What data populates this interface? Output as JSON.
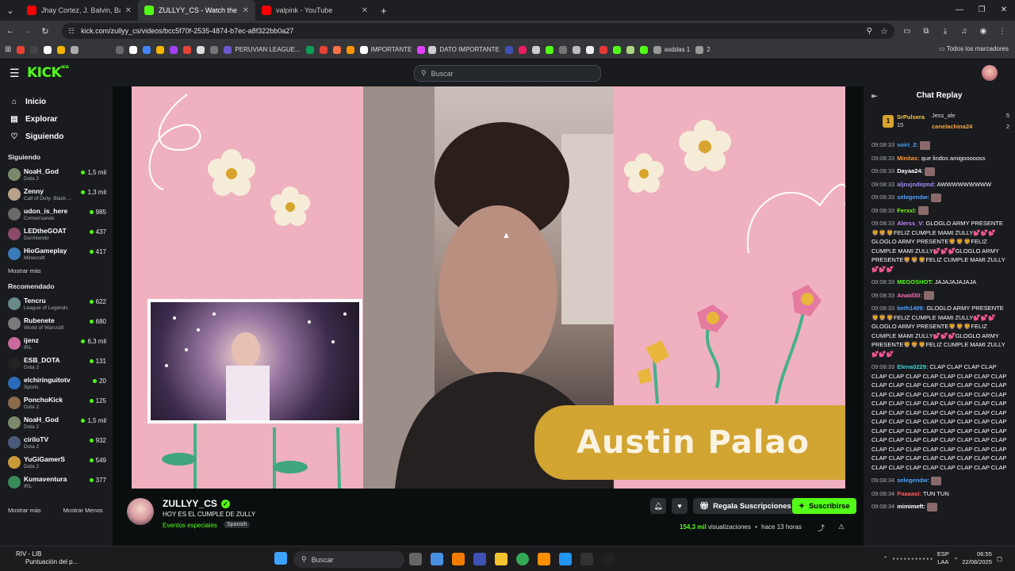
{
  "browser": {
    "tabs": [
      {
        "title": "Jhay Cortez, J. Balvin, Bad Bunny",
        "color": "#ff0000",
        "active": false
      },
      {
        "title": "ZULLYY_CS - Watch the VOD",
        "color": "#53fc18",
        "active": true
      },
      {
        "title": "valpink - YouTube",
        "color": "#ff0000",
        "active": false
      }
    ],
    "new_tab": "+",
    "url": "kick.com/zullyy_cs/videos/bcc5f70f-2535-4874-b7ec-a8f322bb0a27",
    "bookmarks": [
      "PERUVIAN LEAGUE...",
      "IMPORTANTE",
      "DATO IMPORTANTE",
      "asddas 1",
      "2"
    ],
    "all_bookmarks": "Todos los marcadores"
  },
  "kick": {
    "logo": "KICK",
    "logo_badge": "BETA",
    "search_placeholder": "Buscar",
    "nav": [
      {
        "label": "Inicio",
        "icon": "home-icon",
        "glyph": "⌂"
      },
      {
        "label": "Explorar",
        "icon": "browse-icon",
        "glyph": "▤"
      },
      {
        "label": "Siguiendo",
        "icon": "heart-icon",
        "glyph": "♡"
      }
    ],
    "following_title": "Siguiendo",
    "following": [
      {
        "name": "NoaH_God",
        "category": "Dota 2",
        "viewers": "1,5 mil",
        "color": "#7a8a6a"
      },
      {
        "name": "Zenny",
        "category": "Call of Duty: Black ...",
        "viewers": "1,3 mil",
        "color": "#b8a28a"
      },
      {
        "name": "udon_is_here",
        "category": "Conversando",
        "viewers": "985",
        "color": "#6a6a6a"
      },
      {
        "name": "LEDtheGOAT",
        "category": "Durmiendo",
        "viewers": "437",
        "color": "#8a4a6a"
      },
      {
        "name": "HioGameplay",
        "category": "Minecraft",
        "viewers": "417",
        "color": "#3a7ab8"
      }
    ],
    "show_more": "Mostrar más",
    "recommended_title": "Recomendado",
    "recommended": [
      {
        "name": "Tencru",
        "category": "League of Legends",
        "viewers": "622",
        "color": "#6a8a8a"
      },
      {
        "name": "Rubenete",
        "category": "World of Warcraft",
        "viewers": "680",
        "color": "#7a7a7a"
      },
      {
        "name": "ijenz",
        "category": "IRL",
        "viewers": "6,3 mil",
        "color": "#c86a9a"
      },
      {
        "name": "ESB_DOTA",
        "category": "Dota 2",
        "viewers": "131",
        "color": "#222222"
      },
      {
        "name": "elchiringuitotv",
        "category": "Sports",
        "viewers": "20",
        "color": "#2a6ab8"
      },
      {
        "name": "PonchoKick",
        "category": "Dota 2",
        "viewers": "125",
        "color": "#8a6a4a"
      },
      {
        "name": "NoaH_God",
        "category": "Dota 2",
        "viewers": "1,5 mil",
        "color": "#7a8a6a"
      },
      {
        "name": "ciriloTV",
        "category": "Dota 2",
        "viewers": "932",
        "color": "#4a5a7a"
      },
      {
        "name": "YuGiGamerS",
        "category": "Dota 2",
        "viewers": "549",
        "color": "#c89a3a"
      },
      {
        "name": "Kumaventura",
        "category": "IRL",
        "viewers": "377",
        "color": "#3a8a5a"
      }
    ],
    "show_more_2": "Mostrar más",
    "show_less": "Mostrar Menos"
  },
  "video": {
    "banner": "Austin Palao"
  },
  "channel": {
    "name": "ZULLYY_CS",
    "title": "HOY ES EL CUMPLE DE ZULLY",
    "category": "Eventos especiales",
    "language": "Spanish",
    "gift_label": "Regala Suscripciones",
    "subscribe_label": "Suscribirse",
    "views": "154,3 mil",
    "views_label": "visualizaciones",
    "sep": "•",
    "time_ago": "hace 13 horas"
  },
  "chat": {
    "title": "Chat Replay",
    "leaders": [
      {
        "rank": "1",
        "name": "SrPulsera",
        "count": "15"
      },
      {
        "name": "Jess_ale",
        "count": "5"
      },
      {
        "name": "canelachina24",
        "count": "2"
      }
    ],
    "messages": [
      {
        "time": "09:08:33",
        "user": "soiri_2:",
        "color": "#4fa3ff",
        "text": "",
        "emote": true
      },
      {
        "time": "09:08:33",
        "user": "Minitas:",
        "color": "#ff9a3c",
        "text": "que lindos amigoooooss",
        "emote": false
      },
      {
        "time": "09:08:33",
        "user": "Dayaa24:",
        "color": "#ffffff",
        "text": "",
        "emote": true
      },
      {
        "time": "09:08:33",
        "user": "aljnxjndiqmd:",
        "color": "#a78bfa",
        "text": "AWWWWWWWWW",
        "emote": false
      },
      {
        "time": "09:08:33",
        "user": "selegendw:",
        "color": "#4fa3ff",
        "text": "",
        "emote": true
      },
      {
        "time": "09:08:33",
        "user": "Ferxxl:",
        "color": "#7cfc00",
        "text": "",
        "emote": true
      },
      {
        "time": "09:08:33",
        "user": "Alerss_V:",
        "color": "#c084fc",
        "text": "GLOGLO ARMY PRESENTE 🦁🦁🦁FELIZ CUMPLE MAMI ZULLY💕💕💕 GLOGLO ARMY PRESENTE🦁🦁🦁FELIZ CUMPLE MAMI ZULLY💕💕💕GLOGLO ARMY PRESENTE🦁🦁🦁FELIZ CUMPLE MAMI ZULLY💕💕💕",
        "emote": false
      },
      {
        "time": "09:08:33",
        "user": "MEGOSHOT:",
        "color": "#53fc18",
        "text": "JAJAJAJAJAJA",
        "emote": false
      },
      {
        "time": "09:08:33",
        "user": "Anaid30:",
        "color": "#ff6eb4",
        "text": "",
        "emote": true
      },
      {
        "time": "09:08:33",
        "user": "beth1409:",
        "color": "#4fa3ff",
        "text": "GLOGLO ARMY PRESENTE🦁🦁🦁FELIZ CUMPLE MAMI ZULLY💕💕💕 GLOGLO ARMY PRESENTE🦁🦁🦁FELIZ CUMPLE MAMI ZULLY💕💕💕GLOGLO ARMY PRESENTE🦁🦁🦁FELIZ CUMPLE MAMI ZULLY💕💕💕",
        "emote": false
      },
      {
        "time": "09:08:33",
        "user": "Elena0229:",
        "color": "#3ccfcf",
        "text": "CLAP CLAP CLAP CLAP CLAP CLAP CLAP CLAP CLAP CLAP CLAP CLAP CLAP CLAP CLAP CLAP CLAP CLAP CLAP CLAP CLAP CLAP CLAP CLAP CLAP CLAP CLAP CLAP CLAP CLAP CLAP CLAP CLAP CLAP CLAP CLAP CLAP CLAP CLAP CLAP CLAP CLAP CLAP CLAP CLAP CLAP CLAP CLAP CLAP CLAP CLAP CLAP CLAP CLAP CLAP CLAP CLAP CLAP CLAP CLAP CLAP CLAP CLAP CLAP CLAP CLAP CLAP CLAP CLAP CLAP CLAP CLAP CLAP CLAP CLAP CLAP CLAP CLAP CLAP CLAP CLAP CLAP CLAP CLAP CLAP CLAP CLAP CLAP CLAP CLAP CLAP CLAP",
        "emote": false
      },
      {
        "time": "09:08:34",
        "user": "selegendw:",
        "color": "#4fa3ff",
        "text": "",
        "emote": true
      },
      {
        "time": "09:08:34",
        "user": "Paaaaoi:",
        "color": "#ff5a5a",
        "text": "TUN TUN",
        "emote": false
      },
      {
        "time": "09:08:34",
        "user": "mimimeft:",
        "color": "#ffffff",
        "text": "",
        "emote": true
      }
    ]
  },
  "taskbar": {
    "weather_title": "RIV - LIB",
    "weather_sub": "Puntuación del p...",
    "search": "Buscar",
    "lang": "ESP",
    "lang_sub": "LAA",
    "time": "06:55",
    "date": "22/08/2025"
  }
}
